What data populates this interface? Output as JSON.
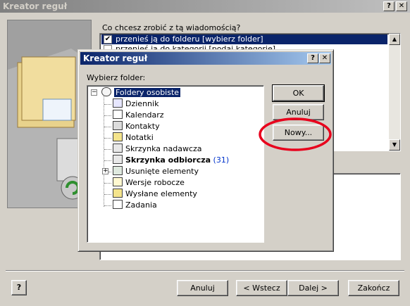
{
  "main_window": {
    "title": "Kreator reguł",
    "help_title_btn": "?",
    "close_title_btn": "✕",
    "question": "Co chcesz zrobić z tą wiadomością?",
    "actions": [
      {
        "label": "przenieś ją do folderu [wybierz folder]",
        "checked": true
      },
      {
        "label": "przenieś ją do kategorii [podaj kategorię]",
        "checked": false
      }
    ],
    "buttons": {
      "help": "?",
      "cancel": "Anuluj",
      "back": "< Wstecz",
      "next": "Dalej >",
      "finish": "Zakończ"
    }
  },
  "dialog": {
    "title": "Kreator reguł",
    "help_title_btn": "?",
    "close_title_btn": "✕",
    "prompt": "Wybierz folder:",
    "buttons": {
      "ok": "OK",
      "cancel": "Anuluj",
      "new": "Nowy..."
    },
    "tree": {
      "root": "Foldery osobiste",
      "items": [
        {
          "label": "Dziennik",
          "count": ""
        },
        {
          "label": "Kalendarz",
          "count": ""
        },
        {
          "label": "Kontakty",
          "count": ""
        },
        {
          "label": "Notatki",
          "count": ""
        },
        {
          "label": "Skrzynka nadawcza",
          "count": ""
        },
        {
          "label": "Skrzynka odbiorcza",
          "count": "(31)"
        },
        {
          "label": "Usunięte elementy",
          "count": ""
        },
        {
          "label": "Wersje robocze",
          "count": ""
        },
        {
          "label": "Wysłane elementy",
          "count": ""
        },
        {
          "label": "Zadania",
          "count": ""
        }
      ]
    }
  },
  "colors": {
    "highlight": "#0a246a",
    "annotation_circle": "#e8001c",
    "count_text": "#0033cc"
  }
}
